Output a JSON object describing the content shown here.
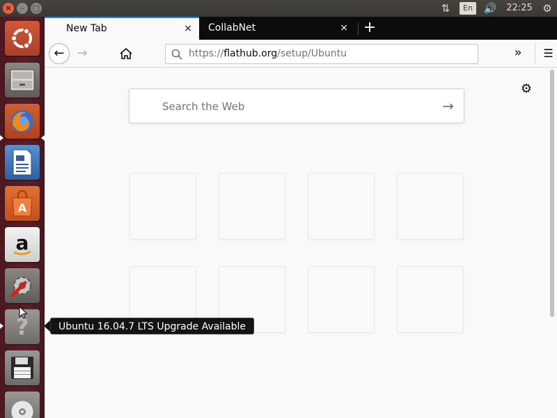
{
  "top_panel": {
    "close_glyph": "×",
    "minimize_glyph": "–",
    "maximize_glyph": "□",
    "network_glyph": "⇅",
    "keyboard_label": "En",
    "volume_glyph": "🔊",
    "clock": "22:25",
    "gear_glyph": "⚙"
  },
  "launcher": {
    "items": [
      {
        "name": "ubuntu-dash"
      },
      {
        "name": "files"
      },
      {
        "name": "firefox",
        "running": true,
        "active": true
      },
      {
        "name": "libreoffice-writer"
      },
      {
        "name": "ubuntu-software"
      },
      {
        "name": "amazon"
      },
      {
        "name": "system-settings"
      },
      {
        "name": "software-updater",
        "running": true
      },
      {
        "name": "save-drive"
      },
      {
        "name": "dvd-drive"
      }
    ],
    "amazon_glyph": "a",
    "help_glyph": "?"
  },
  "browser": {
    "tabs": [
      {
        "label": "New Tab",
        "close": "×"
      },
      {
        "label": "CollabNet",
        "close": "×"
      }
    ],
    "newtab_glyph": "+",
    "back_glyph": "←",
    "forward_glyph": "→",
    "url": {
      "scheme": "https://",
      "host": "flathub.org",
      "path": "/setup/Ubuntu"
    },
    "overflow_glyph": "»",
    "menu_glyph": "☰",
    "settings_glyph": "⚙",
    "search": {
      "placeholder": "Search the Web",
      "go_glyph": "→"
    }
  },
  "tooltip": {
    "text": "Ubuntu 16.04.7 LTS Upgrade Available"
  },
  "colors": {
    "launcher_bg": "#5a1f28",
    "panel_bg": "#3c3b37",
    "accent": "#0a84ff",
    "close_button": "#e8613a"
  }
}
